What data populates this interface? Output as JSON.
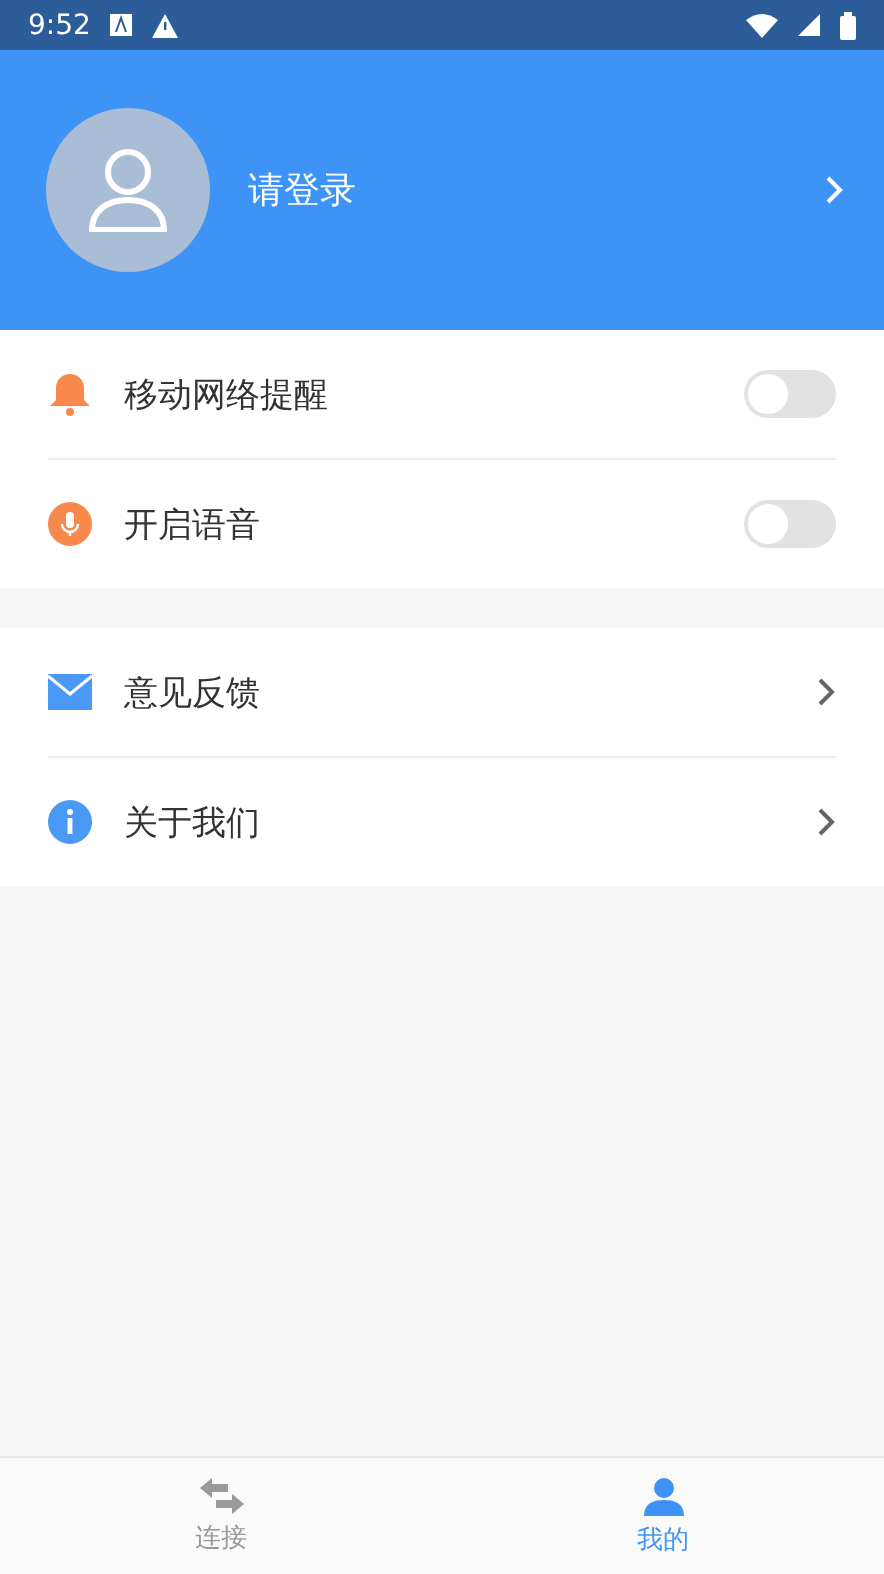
{
  "status_bar": {
    "time": "9:52"
  },
  "profile": {
    "login_label": "请登录"
  },
  "settings": [
    {
      "kind": "toggle",
      "label": "移动网络提醒",
      "on": false
    },
    {
      "kind": "toggle",
      "label": "开启语音",
      "on": false
    }
  ],
  "links": [
    {
      "kind": "link",
      "label": "意见反馈"
    },
    {
      "kind": "link",
      "label": "关于我们"
    }
  ],
  "tabs": [
    {
      "label": "连接",
      "selected": false
    },
    {
      "label": "我的",
      "selected": true
    }
  ]
}
